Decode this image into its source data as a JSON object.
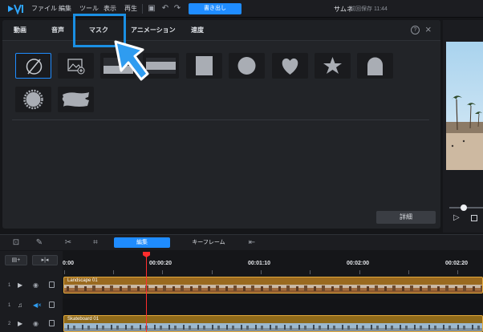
{
  "app": {
    "menus": [
      "ファイル",
      "編集",
      "ツール",
      "表示",
      "再生"
    ],
    "export_label": "書き出し",
    "project_title": "サムネ",
    "save_status": "前回保存 11:44",
    "accent": "#1f8cff"
  },
  "panel": {
    "tabs": [
      {
        "label": "動画"
      },
      {
        "label": "音声"
      },
      {
        "label": "マスク",
        "selected": true
      },
      {
        "label": "アニメーション"
      },
      {
        "label": "速度"
      }
    ],
    "help_glyph": "?",
    "close_glyph": "×",
    "masks": [
      {
        "icon": "none-icon",
        "selected": true
      },
      {
        "icon": "image-mask-icon"
      },
      {
        "icon": "single-line-mask-icon"
      },
      {
        "icon": "double-line-mask-icon"
      },
      {
        "icon": "rectangle-mask-icon"
      },
      {
        "icon": "circle-mask-icon"
      },
      {
        "icon": "heart-mask-icon"
      },
      {
        "icon": "star-mask-icon"
      },
      {
        "icon": "arch-mask-icon"
      },
      {
        "icon": "burst-mask-icon"
      },
      {
        "icon": "brush-mask-icon"
      }
    ],
    "detail_label": "詳細"
  },
  "timeline": {
    "edit_label": "編集",
    "keyframe_label": "キーフレーム",
    "ticks": [
      "0:00",
      "00:00:20",
      "00:01:10",
      "00:02:00",
      "00:02:20"
    ],
    "tracks": [
      {
        "num": "1",
        "type": "video"
      },
      {
        "num": "1",
        "type": "audio"
      },
      {
        "num": "2",
        "type": "video"
      }
    ],
    "clips": [
      {
        "name": "Landscape 01"
      },
      {
        "name": "Skateboard 01"
      }
    ]
  }
}
